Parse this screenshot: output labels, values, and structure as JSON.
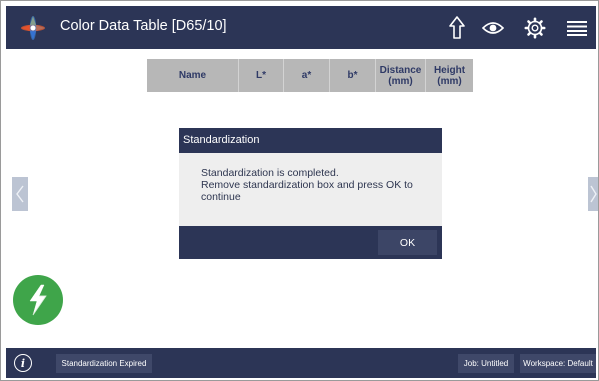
{
  "header": {
    "title": "Color Data Table [D65/10]",
    "icons": [
      "color-wheel-logo-icon",
      "upload-arrow-icon",
      "eye-icon",
      "gear-icon",
      "menu-icon"
    ]
  },
  "table": {
    "columns": [
      {
        "label": "Name"
      },
      {
        "label": "L*"
      },
      {
        "label": "a*"
      },
      {
        "label": "b*"
      },
      {
        "label": "Distance (mm)"
      },
      {
        "label": "Height (mm)"
      }
    ]
  },
  "dialog": {
    "title": "Standardization",
    "message_line1": "Standardization is completed.",
    "message_line2": "Remove standardization box and press OK to",
    "message_line3": "continue",
    "ok_label": "OK"
  },
  "footer": {
    "status_label": "Standardization Expired",
    "job_label": "Job: Untitled",
    "workspace_label": "Workspace: Default"
  },
  "colors": {
    "bar": "#2c3556",
    "accent_green": "#3fa54a",
    "table_header": "#b7b7b7"
  }
}
